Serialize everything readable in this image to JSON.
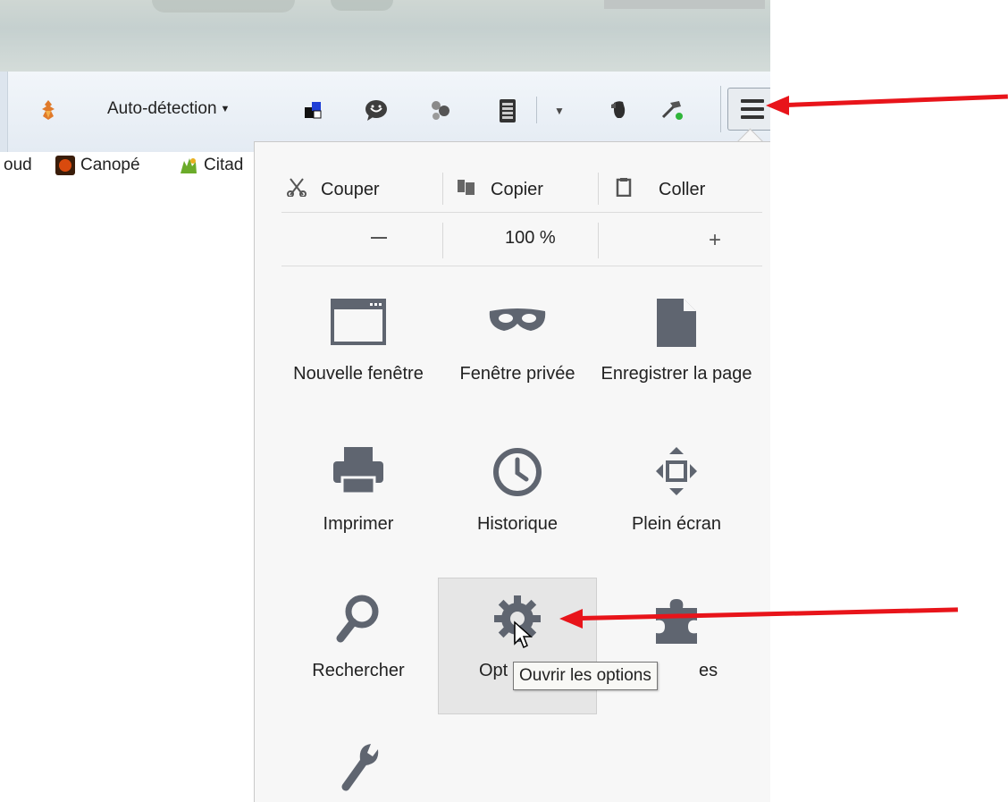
{
  "toolbar": {
    "encoding_label": "Auto-détection",
    "icons": [
      "firebug-icon",
      "encoding-icon",
      "dropdown-caret-icon",
      "colorzilla-icon",
      "chat-icon",
      "molecule-icon",
      "clipboard-icon",
      "evernote-icon",
      "hammer-icon",
      "menu-icon"
    ]
  },
  "bookmarks": {
    "items": [
      {
        "label": "oud"
      },
      {
        "label": "Canopé"
      },
      {
        "label": "Citad"
      }
    ]
  },
  "panel": {
    "edit": {
      "cut": "Couper",
      "copy": "Copier",
      "paste": "Coller"
    },
    "zoom": {
      "minus": "−",
      "value": "100 %",
      "plus": "+"
    },
    "items": {
      "new_window": "Nouvelle fenêtre",
      "private_window": "Fenêtre privée",
      "save_page": "Enregistrer la page",
      "print": "Imprimer",
      "history": "Historique",
      "fullscreen": "Plein écran",
      "search": "Rechercher",
      "options_partial": "Opt",
      "addons_partial": "es"
    },
    "tooltip": "Ouvrir les options"
  },
  "colors": {
    "annotation_arrow": "#e8141a",
    "icon_gray": "#5f6570",
    "panel_bg": "#f7f7f7"
  }
}
